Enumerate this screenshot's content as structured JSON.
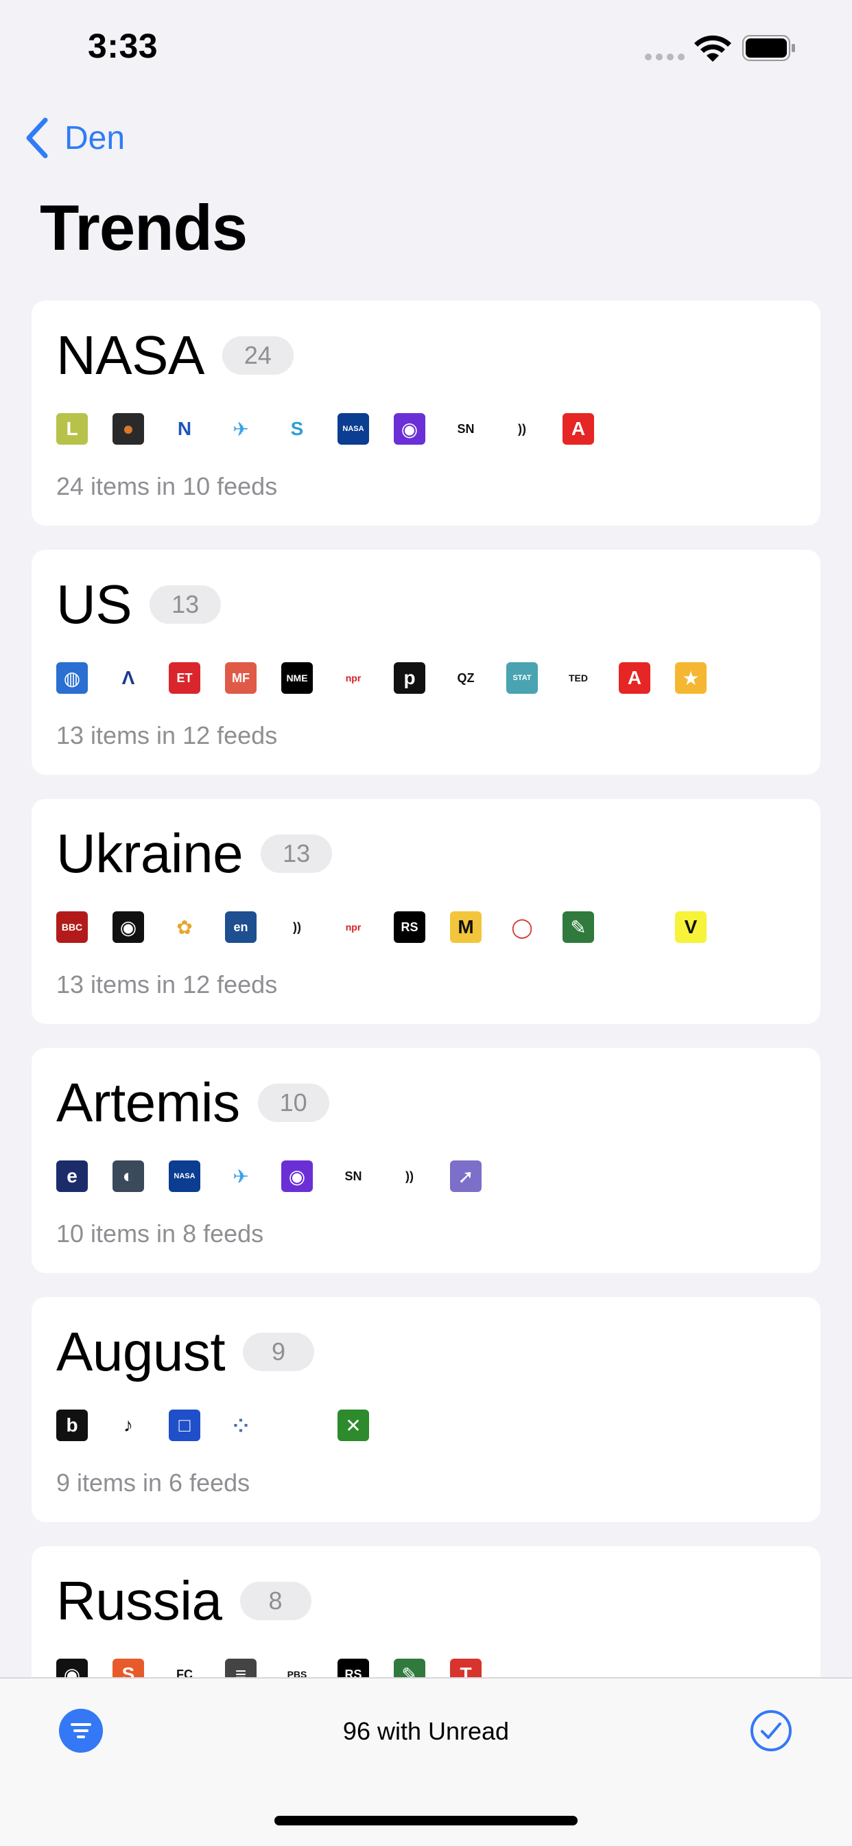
{
  "status_bar": {
    "time": "3:33"
  },
  "nav": {
    "back_label": "Den"
  },
  "page": {
    "title": "Trends"
  },
  "trends": [
    {
      "title": "NASA",
      "count": "24",
      "summary": "24 items in 10 feeds",
      "icons": [
        {
          "name": "feed-l-icon",
          "bg": "#b7c24a",
          "text": "L"
        },
        {
          "name": "mars-icon",
          "bg": "#2a2a2a",
          "text": "●",
          "color": "#d9772b"
        },
        {
          "name": "feed-n-icon",
          "bg": "#ffffff",
          "text": "N",
          "color": "#1e56b8"
        },
        {
          "name": "swift-bird-icon",
          "bg": "#ffffff",
          "text": "✈",
          "color": "#3aa2e8"
        },
        {
          "name": "feed-s-icon",
          "bg": "#ffffff",
          "text": "S",
          "color": "#2e9fd6"
        },
        {
          "name": "nasa-icon",
          "bg": "#0b3d91",
          "text": "NASA"
        },
        {
          "name": "purple-ring-icon",
          "bg": "#6b2fd6",
          "text": "◉"
        },
        {
          "name": "sn-icon",
          "bg": "#ffffff",
          "text": "SN",
          "color": "#111111"
        },
        {
          "name": "rss-icon",
          "bg": "#ffffff",
          "text": "))",
          "color": "#111111"
        },
        {
          "name": "feed-red-a-icon",
          "bg": "#e62525",
          "text": "A"
        }
      ]
    },
    {
      "title": "US",
      "count": "13",
      "summary": "13 items in 12 feeds",
      "icons": [
        {
          "name": "globe-icon",
          "bg": "#2a6fd1",
          "text": "◍"
        },
        {
          "name": "axios-icon",
          "bg": "#ffffff",
          "text": "Λ",
          "color": "#1a3a8c"
        },
        {
          "name": "et-icon",
          "bg": "#d9262c",
          "text": "ET"
        },
        {
          "name": "mf-icon",
          "bg": "#e05a48",
          "text": "MF"
        },
        {
          "name": "nme-icon",
          "bg": "#000000",
          "text": "NME"
        },
        {
          "name": "npr-icon",
          "bg": "#ffffff",
          "text": "npr",
          "color": "#d62021"
        },
        {
          "name": "pocket-icon",
          "bg": "#111111",
          "text": "p"
        },
        {
          "name": "qz-icon",
          "bg": "#ffffff",
          "text": "QZ",
          "color": "#111111"
        },
        {
          "name": "stat-icon",
          "bg": "#4aa3b0",
          "text": "STAT"
        },
        {
          "name": "ted-icon",
          "bg": "#ffffff",
          "text": "TED",
          "color": "#111111"
        },
        {
          "name": "feed-red-a-icon",
          "bg": "#e62525",
          "text": "A"
        },
        {
          "name": "star-icon",
          "bg": "#f5b731",
          "text": "★"
        }
      ]
    },
    {
      "title": "Ukraine",
      "count": "13",
      "summary": "13 items in 12 feeds",
      "icons": [
        {
          "name": "bbc-news-icon",
          "bg": "#b31b1b",
          "text": "BBC"
        },
        {
          "name": "cbs-eye-icon",
          "bg": "#111111",
          "text": "◉"
        },
        {
          "name": "nbc-peacock-icon",
          "bg": "#ffffff",
          "text": "✿",
          "color": "#e8a52b"
        },
        {
          "name": "en-icon",
          "bg": "#1d4f91",
          "text": "en"
        },
        {
          "name": "rss-icon",
          "bg": "#ffffff",
          "text": "))",
          "color": "#111111"
        },
        {
          "name": "npr-icon",
          "bg": "#ffffff",
          "text": "npr",
          "color": "#d62021"
        },
        {
          "name": "rs-icon",
          "bg": "#000000",
          "text": "RS"
        },
        {
          "name": "m-icon",
          "bg": "#f2c53d",
          "text": "M",
          "color": "#111111"
        },
        {
          "name": "speech-bubble-icon",
          "bg": "#ffffff",
          "text": "◯",
          "color": "#d6342c"
        },
        {
          "name": "leaf-icon",
          "bg": "#2f7a3c",
          "text": "✎"
        },
        {
          "name": "blank-icon",
          "bg": "#ffffff",
          "text": ""
        },
        {
          "name": "v-icon",
          "bg": "#f7f23a",
          "text": "V",
          "color": "#111111"
        }
      ]
    },
    {
      "title": "Artemis",
      "count": "10",
      "summary": "10 items in 8 feeds",
      "icons": [
        {
          "name": "e-icon",
          "bg": "#1c2c6b",
          "text": "e"
        },
        {
          "name": "moon-icon",
          "bg": "#3a4a5a",
          "text": "◐"
        },
        {
          "name": "nasa-icon",
          "bg": "#0b3d91",
          "text": "NASA"
        },
        {
          "name": "swift-bird-icon",
          "bg": "#ffffff",
          "text": "✈",
          "color": "#3aa2e8"
        },
        {
          "name": "purple-ring-icon",
          "bg": "#6b2fd6",
          "text": "◉"
        },
        {
          "name": "sn-icon",
          "bg": "#ffffff",
          "text": "SN",
          "color": "#111111"
        },
        {
          "name": "rss-icon",
          "bg": "#ffffff",
          "text": "))",
          "color": "#111111"
        },
        {
          "name": "rocket-icon",
          "bg": "#7b6fc9",
          "text": "➚"
        }
      ]
    },
    {
      "title": "August",
      "count": "9",
      "summary": "9 items in 6 feeds",
      "icons": [
        {
          "name": "b-icon",
          "bg": "#111111",
          "text": "b"
        },
        {
          "name": "piano-icon",
          "bg": "#ffffff",
          "text": "♪",
          "color": "#111111"
        },
        {
          "name": "square-icon",
          "bg": "#1f4fc9",
          "text": "□"
        },
        {
          "name": "dots-icon",
          "bg": "#ffffff",
          "text": "⁘",
          "color": "#4a6fb5"
        },
        {
          "name": "blank-icon",
          "bg": "#ffffff",
          "text": ""
        },
        {
          "name": "xbox-icon",
          "bg": "#2d8a2d",
          "text": "✕"
        }
      ]
    },
    {
      "title": "Russia",
      "count": "8",
      "summary": "",
      "icons": [
        {
          "name": "cbs-eye-icon",
          "bg": "#111111",
          "text": "◉"
        },
        {
          "name": "feed-orange-icon",
          "bg": "#e85a2a",
          "text": "S"
        },
        {
          "name": "fc-icon",
          "bg": "#ffffff",
          "text": "FC",
          "color": "#111111"
        },
        {
          "name": "feed-striped-icon",
          "bg": "#444444",
          "text": "≡"
        },
        {
          "name": "pbs-icon",
          "bg": "#ffffff",
          "text": "PBS",
          "color": "#111111"
        },
        {
          "name": "rs-icon",
          "bg": "#000000",
          "text": "RS"
        },
        {
          "name": "leaf-icon",
          "bg": "#2f7a3c",
          "text": "✎"
        },
        {
          "name": "feed-red-icon",
          "bg": "#d6342c",
          "text": "T"
        }
      ]
    }
  ],
  "toolbar": {
    "unread_label": "96 with Unread"
  },
  "colors": {
    "accent": "#3478f6",
    "secondary_text": "#8e8e93",
    "background": "#f2f2f7"
  }
}
